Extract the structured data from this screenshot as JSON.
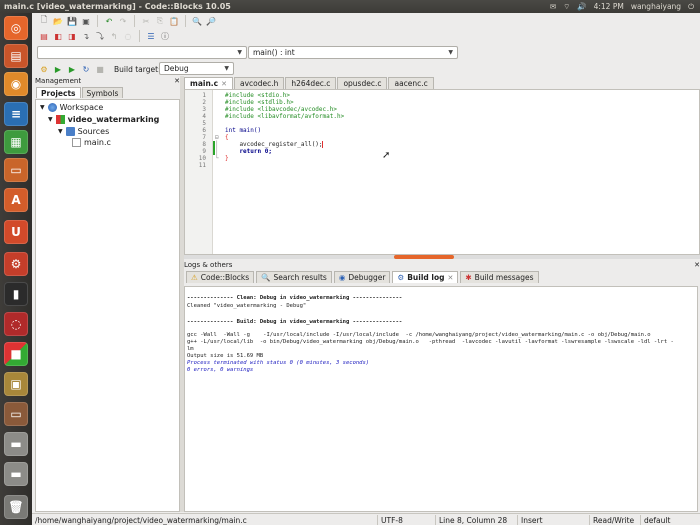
{
  "window": {
    "title": "main.c [video_watermarking] - Code::Blocks 10.05"
  },
  "tray": {
    "mail": "✉",
    "wifi": "⌔",
    "volume": "🔊",
    "time": "4:12 PM",
    "user": "wanghaiyang"
  },
  "toolbar": {
    "func_combo": "main() : int",
    "build_target_label": "Build target:",
    "build_target_value": "Debug"
  },
  "management": {
    "title": "Management",
    "tabs": [
      "Projects",
      "Symbols"
    ],
    "tree": {
      "workspace": "Workspace",
      "project": "video_watermarking",
      "folder": "Sources",
      "file": "main.c"
    }
  },
  "editor": {
    "tabs": [
      "main.c",
      "avcodec.h",
      "h264dec.c",
      "opusdec.c",
      "aacenc.c"
    ],
    "line_numbers": [
      "1",
      "2",
      "3",
      "4",
      "5",
      "6",
      "7",
      "8",
      "9",
      "10",
      "11"
    ],
    "lines": [
      "#include <stdio.h>",
      "#include <stdlib.h>",
      "#include <libavcodec/avcodec.h>",
      "#include <libavformat/avformat.h>",
      "",
      "int main()",
      "{",
      "    avcodec_register_all();",
      "    return 0;",
      "}",
      ""
    ]
  },
  "logs": {
    "title": "Logs & others",
    "tabs": [
      "Code::Blocks",
      "Search results",
      "Debugger",
      "Build log",
      "Build messages"
    ],
    "lines": [
      "-------------- Clean: Debug in video_watermarking ---------------",
      "Cleaned \"video_watermarking - Debug\"",
      "",
      "-------------- Build: Debug in video_watermarking ---------------",
      "",
      "gcc -Wall  -Wall -g    -I/usr/local/include -I/usr/local/include  -c /home/wanghaiyang/project/video_watermarking/main.c -o obj/Debug/main.o",
      "g++ -L/usr/local/lib  -o bin/Debug/video_watermarking obj/Debug/main.o   -pthread  -lavcodec -lavutil -lavformat -lswresample -lswscale -ldl -lrt -",
      "lm",
      "Output size is 51.69 MB",
      "Process terminated with status 0 (0 minutes, 3 seconds)",
      "0 errors, 0 warnings"
    ]
  },
  "statusbar": {
    "path": "/home/wanghaiyang/project/video_watermarking/main.c",
    "encoding": "UTF-8",
    "position": "Line 8, Column 28",
    "mode": "Insert",
    "access": "Read/Write",
    "profile": "default"
  },
  "launcher_icons": [
    "ubuntu-dash-icon",
    "files-icon",
    "firefox-icon",
    "writer-icon",
    "calc-icon",
    "impress-icon",
    "software-center-icon",
    "ubuntu-one-icon",
    "settings-icon",
    "terminal-icon",
    "disk-icon",
    "codeblocks-icon",
    "archive-icon",
    "presentation-icon",
    "drive-icon",
    "drive2-icon",
    "trash-icon"
  ]
}
